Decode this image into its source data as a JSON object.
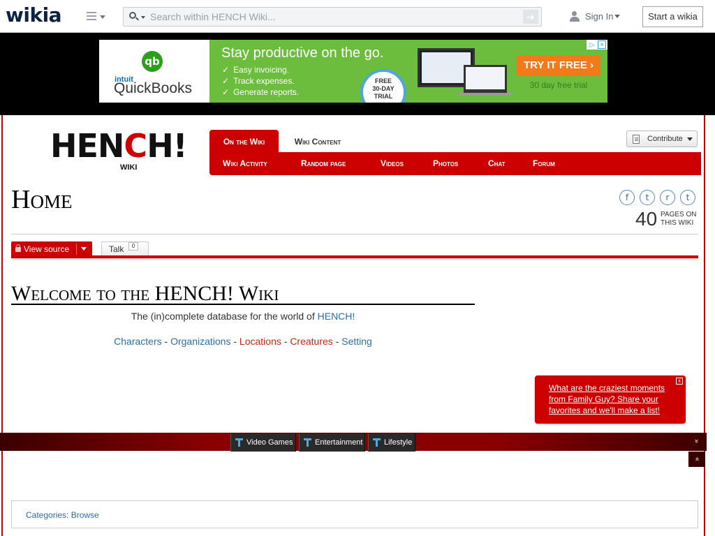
{
  "topnav": {
    "logo": "wikia",
    "search_placeholder": "Search within HENCH Wiki...",
    "go_arrow": "➔",
    "sign_in": "Sign In",
    "start_wikia": "Start a wikia"
  },
  "ad": {
    "brand_glyph": "qb",
    "brand_intuit": "intuit",
    "brand_name": "QuickBooks",
    "headline": "Stay productive on the go.",
    "bullets": [
      "Easy invoicing.",
      "Track expenses.",
      "Generate reports."
    ],
    "trial_badge": [
      "FREE",
      "30-DAY",
      "TRIAL"
    ],
    "cta": "TRY IT FREE ›",
    "cta_sub": "30 day free trial",
    "choices_i": "▷",
    "choices_x": "×",
    "brand_color": "#2ca01c",
    "panel_color": "#6cbd3e",
    "cta_color": "#f27a1a"
  },
  "wiki": {
    "logo_main_a": "HEN",
    "logo_main_b": "C",
    "logo_main_c": "H!",
    "logo_sub": "WIKI",
    "accent_color": "#cc0000",
    "tabs": [
      "On the Wiki",
      "Wiki Content"
    ],
    "subnav": [
      "Wiki Activity",
      "Random page",
      "Videos",
      "Photos",
      "Chat",
      "Forum"
    ],
    "contribute": "Contribute",
    "social_icons": [
      "facebook-icon",
      "twitter-icon",
      "reddit-icon",
      "tumblr-icon"
    ],
    "social_glyphs": [
      "f",
      "t",
      "r",
      "t"
    ],
    "page_count": "40",
    "page_count_label": "Pages on this wiki"
  },
  "page": {
    "title": "Home",
    "view_source": "View source",
    "talk": "Talk",
    "talk_count": "0",
    "welcome_heading": "Welcome to the HENCH! Wiki",
    "tagline_prefix": "The (in)complete database for the world of ",
    "tagline_link": "HENCH!",
    "nav_links": [
      {
        "label": "Characters",
        "color": "#2a6ea8"
      },
      {
        "label": "Organizations",
        "color": "#2a6ea8"
      },
      {
        "label": "Locations",
        "color": "#c4260f"
      },
      {
        "label": "Creatures",
        "color": "#c4260f"
      },
      {
        "label": "Setting",
        "color": "#2a6ea8"
      }
    ],
    "nav_separator": " - ",
    "categories_label": "Categories:",
    "categories_link": "Browse"
  },
  "notification": {
    "message": "What are the craziest moments from Family Guy? Share your favorites and we'll make a list!",
    "close": "x"
  },
  "footer_toolbar": {
    "items": [
      "Video Games",
      "Entertainment",
      "Lifestyle"
    ],
    "collapse": "»",
    "to_top": "«"
  }
}
